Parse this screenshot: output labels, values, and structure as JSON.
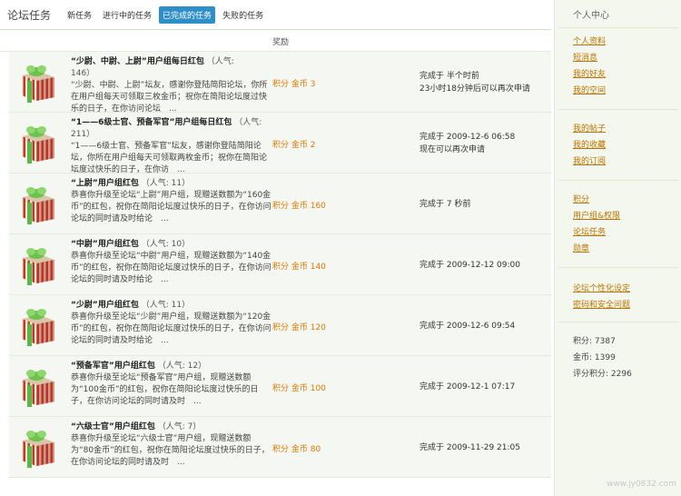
{
  "header": {
    "title": "论坛任务",
    "tabs": [
      {
        "label": "新任务",
        "active": false
      },
      {
        "label": "进行中的任务",
        "active": false
      },
      {
        "label": "已完成的任务",
        "active": true
      },
      {
        "label": "失败的任务",
        "active": false
      }
    ]
  },
  "table": {
    "reward_header": "奖励",
    "rows": [
      {
        "title": "“少尉、中尉、上尉”用户组每日红包",
        "popular": "（人气:",
        "popular2": "146）",
        "desc": "“少尉、中尉、上尉”坛友，感谢你登陆简阳论坛，你所在用户组每天可领取三枚金币；祝你在简阳论坛度过快乐的日子，在你访问论坛　...",
        "reward": "积分 金币 3",
        "status": [
          "完成于 半个时前",
          "23小时18分钟后可以再次申请"
        ]
      },
      {
        "title": "“1——6级士官、预备军官”用户组每日红包",
        "popular": "（人气: 211）",
        "popular2": "",
        "desc": "“1——6级士官、预备军官”坛友，感谢你登陆简阳论坛，你所在用户组每天可领取两枚金币；祝你在简阳论坛度过快乐的日子，在你访　...",
        "reward": "积分 金币 2",
        "status": [
          "完成于 2009-12-6 06:58",
          "现在可以再次申请"
        ]
      },
      {
        "title": "“上尉”用户组红包",
        "popular": "（人气: 11）",
        "popular2": "",
        "desc": "恭喜你升级至论坛“上尉”用户组，现赠送数额为“160金币”的红包，祝你在简阳论坛度过快乐的日子，在你访问论坛的同时请及时给论　...",
        "reward": "积分 金币 160",
        "status": [
          "完成于 7 秒前"
        ]
      },
      {
        "title": "“中尉”用户组红包",
        "popular": "（人气: 10）",
        "popular2": "",
        "desc": "恭喜你升级至论坛“中尉”用户组，现赠送数额为“140金币”的红包，祝你在简阳论坛度过快乐的日子，在你访问论坛的同时请及时给论　...",
        "reward": "积分 金币 140",
        "status": [
          "完成于 2009-12-12 09:00"
        ]
      },
      {
        "title": "“少尉”用户组红包",
        "popular": "（人气: 11）",
        "popular2": "",
        "desc": "恭喜你升级至论坛“少尉”用户组，现赠送数额为“120金币”的红包，祝你在简阳论坛度过快乐的日子，在你访问论坛的同时请及时给论　...",
        "reward": "积分 金币 120",
        "status": [
          "完成于 2009-12-6 09:54"
        ]
      },
      {
        "title": "“预备军官”用户组红包",
        "popular": "（人气: 12）",
        "popular2": "",
        "desc": "恭喜你升级至论坛“预备军官”用户组，现赠送数额为“100金币”的红包，祝你在简阳论坛度过快乐的日子，在你访问论坛的同时请及时　...",
        "reward": "积分 金币 100",
        "status": [
          "完成于 2009-12-1 07:17"
        ]
      },
      {
        "title": "“六级士官”用户组红包",
        "popular": "（人气: 7）",
        "popular2": "",
        "desc": "恭喜你升级至论坛“六级士官”用户组，现赠送数额为“80金币”的红包，祝你在简阳论坛度过快乐的日子，在你访问论坛的同时请及时　...",
        "reward": "积分 金币 80",
        "status": [
          "完成于 2009-11-29 21:05"
        ]
      }
    ]
  },
  "sidebar": {
    "title": "个人中心",
    "group1": [
      "个人资料",
      "短消息",
      "我的好友",
      "我的空间"
    ],
    "group2": [
      "我的帖子",
      "我的收藏",
      "我的订阅"
    ],
    "group3": [
      "积分",
      "用户组&权限",
      "论坛任务",
      "勋章"
    ],
    "group4": [
      "论坛个性化设定",
      "密码和安全问题"
    ],
    "stats": [
      "积分: 7387",
      "金币: 1399",
      "评分积分: 2296"
    ]
  },
  "watermark": "www.jy0832.com"
}
